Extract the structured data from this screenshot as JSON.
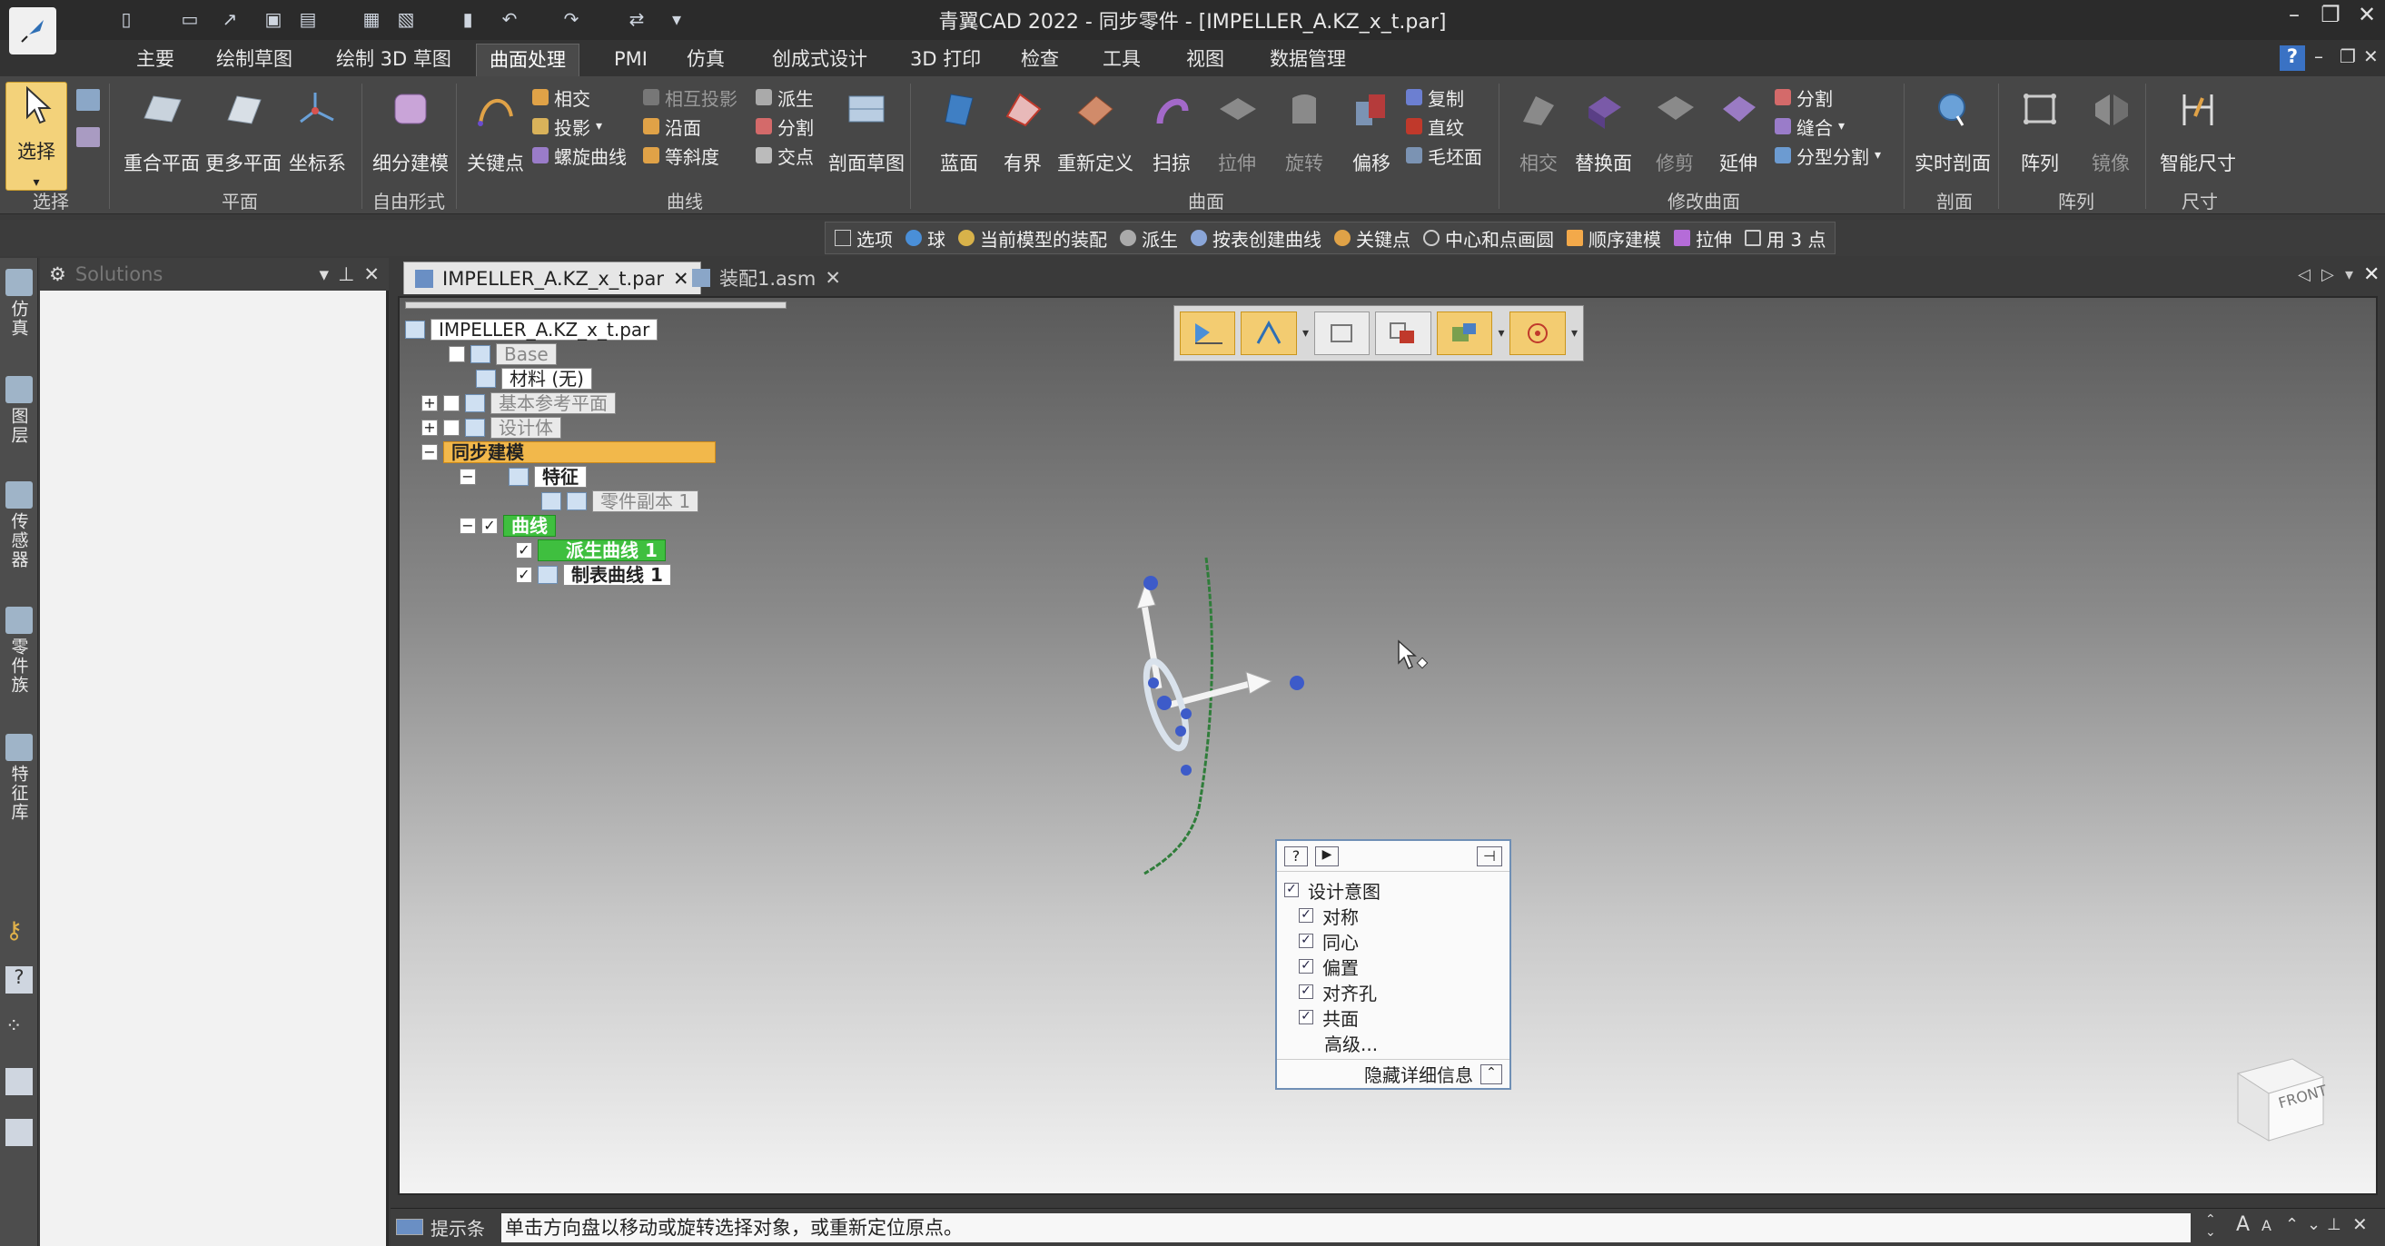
{
  "window": {
    "title": "青翼CAD 2022 - 同步零件 - [IMPELLER_A.KZ_x_t.par]"
  },
  "menu_tabs": [
    "主要",
    "绘制草图",
    "绘制 3D 草图",
    "曲面处理",
    "PMI",
    "仿真",
    "创成式设计",
    "3D 打印",
    "检查",
    "工具",
    "视图",
    "数据管理"
  ],
  "active_menu_tab": "曲面处理",
  "ribbon": {
    "select": {
      "label": "选择",
      "group": "选择"
    },
    "plane_group": {
      "label": "平面",
      "buttons": [
        "重合平面",
        "更多平面",
        "坐标系"
      ]
    },
    "freeform_group": {
      "label": "自由形式",
      "buttons": [
        "细分建模"
      ]
    },
    "curve_group": {
      "label": "曲线",
      "keypoint": "关键点",
      "col1": [
        "相交",
        "投影",
        "螺旋曲线"
      ],
      "col2": [
        "相互投影",
        "沿面",
        "等斜度"
      ],
      "col3": [
        "派生",
        "分割",
        "交点"
      ],
      "section": "剖面草图"
    },
    "surface_group": {
      "label": "曲面",
      "buttons": [
        "蓝面",
        "有界",
        "重新定义",
        "扫掠",
        "拉伸",
        "旋转",
        "偏移"
      ],
      "small": [
        "复制",
        "直纹",
        "毛坯面"
      ]
    },
    "modify_group": {
      "label": "修改曲面",
      "buttons": [
        "相交",
        "替换面",
        "修剪",
        "延伸"
      ],
      "small": [
        "分割",
        "缝合",
        "分型分割"
      ]
    },
    "section_group": {
      "label": "剖面",
      "buttons": [
        "实时剖面"
      ]
    },
    "pattern_group": {
      "label": "阵列",
      "buttons": [
        "阵列",
        "镜像"
      ]
    },
    "dimension_group": {
      "label": "尺寸",
      "buttons": [
        "智能尺寸"
      ]
    }
  },
  "command_bar": [
    "选项",
    "球",
    "当前模型的装配",
    "派生",
    "按表创建曲线",
    "关键点",
    "中心和点画圆",
    "顺序建模",
    "拉伸",
    "用 3 点"
  ],
  "left_rail": [
    "仿真",
    "图层",
    "传感器",
    "零件族",
    "特征库"
  ],
  "side_panel": {
    "title": "Solutions"
  },
  "doc_tabs": [
    {
      "label": "IMPELLER_A.KZ_x_t.par",
      "active": true
    },
    {
      "label": "装配1.asm",
      "active": false
    }
  ],
  "tree": {
    "root": "IMPELLER_A.KZ_x_t.par",
    "base": "Base",
    "material": "材料 (无)",
    "ref_planes": "基本参考平面",
    "design_body": "设计体",
    "sync": "同步建模",
    "features": "特征",
    "part_copy": "零件副本 1",
    "curves": "曲线",
    "derived_curve": "派生曲线 1",
    "table_curve": "制表曲线 1"
  },
  "intent_panel": {
    "title": "设计意图",
    "items": [
      "对称",
      "同心",
      "偏置",
      "对齐孔",
      "共面"
    ],
    "advanced": "高级...",
    "hide_details": "隐藏详细信息"
  },
  "viewcube": {
    "face": "FRONT"
  },
  "status": {
    "label": "提示条",
    "prompt": "单击方向盘以移动或旋转选择对象，或重新定位原点。"
  },
  "colors": {
    "accent": "#f3cc71",
    "tree_green": "#3fbf3f",
    "tree_orange": "#f2b84b"
  }
}
